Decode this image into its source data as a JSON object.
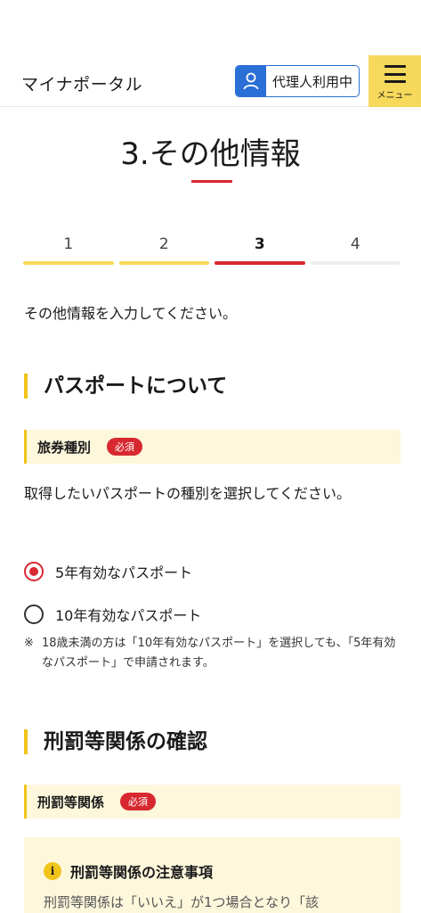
{
  "header": {
    "app_title": "マイナポータル",
    "proxy_label": "代理人利用中",
    "menu_label": "メニュー"
  },
  "page": {
    "title": "3.その他情報",
    "intro": "その他情報を入力してください。"
  },
  "stepper": {
    "steps": [
      {
        "label": "1",
        "state": "done",
        "color": "#f6d85a"
      },
      {
        "label": "2",
        "state": "done",
        "color": "#f6d85a"
      },
      {
        "label": "3",
        "state": "current",
        "color": "#d7282f"
      },
      {
        "label": "4",
        "state": "upcoming",
        "color": "#eeeeee"
      }
    ]
  },
  "passport": {
    "heading": "パスポートについて",
    "field_label": "旅券種別",
    "required": "必須",
    "description": "取得したいパスポートの種別を選択してください。",
    "options": [
      {
        "label": "5年有効なパスポート",
        "checked": true
      },
      {
        "label": "10年有効なパスポート",
        "checked": false
      }
    ],
    "note_mark": "※",
    "note": "18歳未満の方は「10年有効なパスポート」を選択しても、「5年有効なパスポート」で申請されます。"
  },
  "penalty": {
    "heading": "刑罰等関係の確認",
    "field_label": "刑罰等関係",
    "required": "必須",
    "notice_icon": "i",
    "notice_title": "刑罰等関係の注意事項",
    "notice_body": "刑罰等関係は「いいえ」が1つ場合となり「該"
  },
  "colors": {
    "accent_red": "#d7282f",
    "accent_yellow": "#f6d85a",
    "proxy_blue": "#2a6fd6",
    "label_bg": "#fdf7dc"
  }
}
